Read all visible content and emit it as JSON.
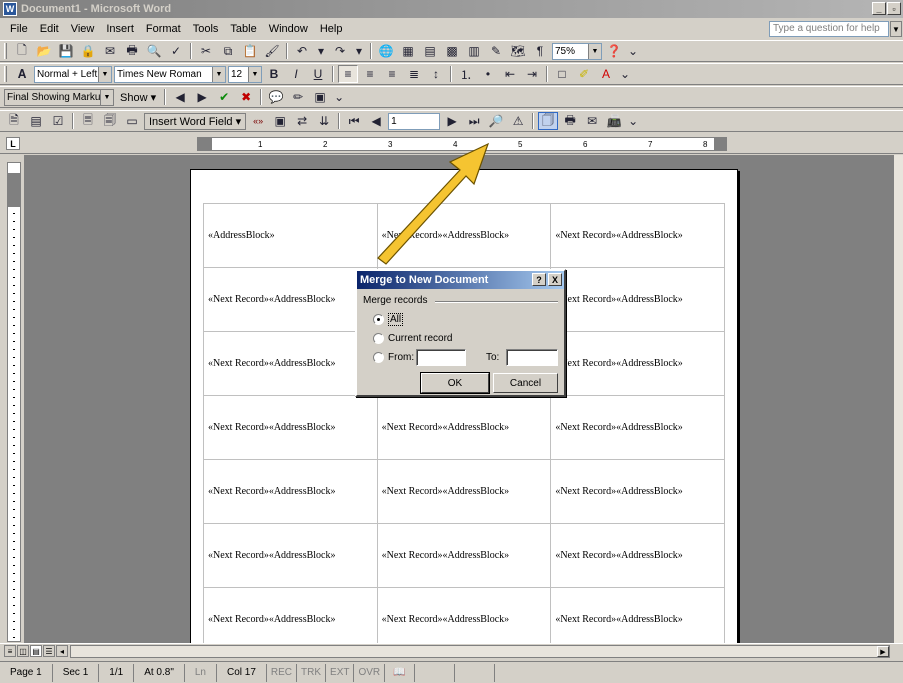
{
  "window": {
    "title": "Document1 - Microsoft Word",
    "app_icon": "W",
    "minimize": "_",
    "restore": "▫"
  },
  "menu": {
    "items": [
      "File",
      "Edit",
      "View",
      "Insert",
      "Format",
      "Tools",
      "Table",
      "Window",
      "Help"
    ]
  },
  "help_box": {
    "placeholder": "Type a question for help"
  },
  "standard_toolbar": {
    "zoom": "75%"
  },
  "formatting_toolbar": {
    "style": "Normal + Left:",
    "font": "Times New Roman",
    "size": "12"
  },
  "reviewing_toolbar": {
    "display": "Final Showing Markup",
    "show_label": "Show ▾"
  },
  "mail_merge_toolbar": {
    "insert_word_field": "Insert Word Field ▾",
    "record_number": "1"
  },
  "ruler": {
    "ticks": [
      "1",
      "2",
      "3",
      "4",
      "5",
      "6",
      "7",
      "8"
    ]
  },
  "document": {
    "first_label": "«AddressBlock»",
    "labels": [
      [
        "«AddressBlock»",
        "«Next Record»«AddressBlock»",
        "«Next Record»«AddressBlock»"
      ],
      [
        "«Next Record»«AddressBlock»",
        "",
        "«Next Record»«AddressBlock»"
      ],
      [
        "«Next Record»«AddressBlock»",
        "",
        "«Next Record»«AddressBlock»"
      ],
      [
        "«Next Record»«AddressBlock»",
        "«Next Record»«AddressBlock»",
        "«Next Record»«AddressBlock»"
      ],
      [
        "«Next Record»«AddressBlock»",
        "«Next Record»«AddressBlock»",
        "«Next Record»«AddressBlock»"
      ],
      [
        "«Next Record»«AddressBlock»",
        "«Next Record»«AddressBlock»",
        "«Next Record»«AddressBlock»"
      ],
      [
        "«Next Record»«AddressBlock»",
        "«Next Record»«AddressBlock»",
        "«Next Record»«AddressBlock»"
      ]
    ]
  },
  "dialog": {
    "title": "Merge to New Document",
    "help_btn": "?",
    "close_btn": "X",
    "group_label": "Merge records",
    "option_all": "All",
    "option_current": "Current record",
    "option_from": "From:",
    "to_label": "To:",
    "ok": "OK",
    "cancel": "Cancel"
  },
  "status": {
    "page": "Page 1",
    "sec": "Sec 1",
    "pages": "1/1",
    "at": "At 0.8\"",
    "ln": "Ln",
    "col": "Col 17",
    "rec": "REC",
    "trk": "TRK",
    "ext": "EXT",
    "ovr": "OVR"
  },
  "colors": {
    "arrow": "#f5c431",
    "title_active": "#0a246a",
    "title_inactive": "#808080"
  }
}
